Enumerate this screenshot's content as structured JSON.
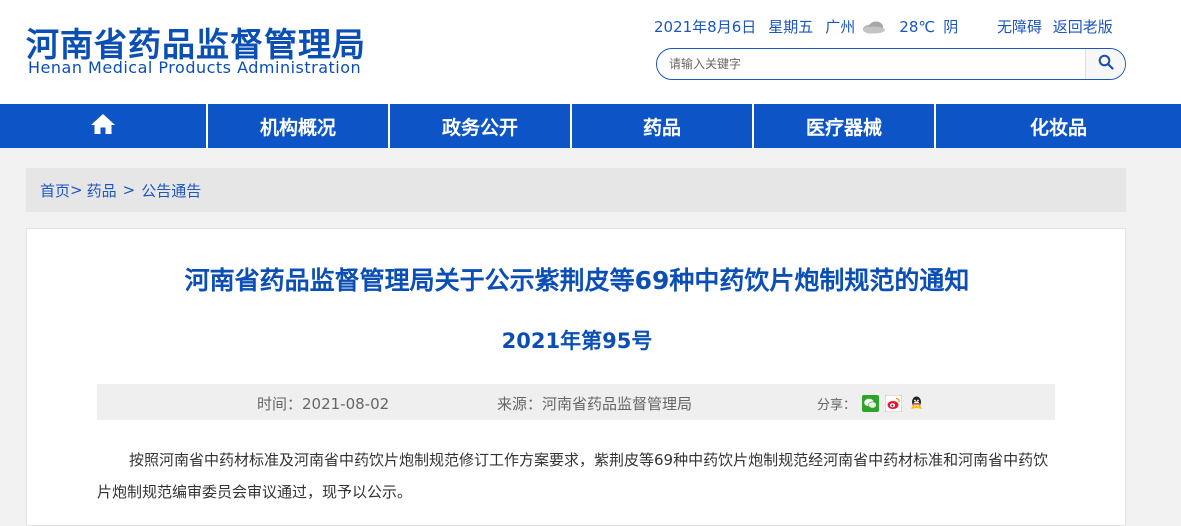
{
  "header": {
    "logo_cn": "河南省药品监督管理局",
    "logo_en": "Henan Medical Products Administration",
    "date": "2021年8月6日",
    "weekday": "星期五",
    "city": "广州",
    "weather_icon": "cloud-icon",
    "temperature": "28℃",
    "weather": "阴",
    "accessibility_link": "无障碍",
    "old_version_link": "返回老版",
    "search_placeholder": "请输入关键字",
    "search_icon": "search-icon"
  },
  "nav": {
    "home_icon": "home-icon",
    "items": [
      "机构概况",
      "政务公开",
      "药品",
      "医疗器械",
      "化妆品"
    ]
  },
  "breadcrumb": {
    "items": [
      "首页",
      "药品",
      "公告通告"
    ],
    "separators": [
      ">",
      ">"
    ]
  },
  "article": {
    "title": "河南省药品监督管理局关于公示紫荆皮等69种中药饮片炮制规范的通知",
    "number": "2021年第95号",
    "time": "时间：2021-08-02",
    "source": "来源：河南省药品监督管理局",
    "share_label": "分享：",
    "share_icons": [
      "wechat-icon",
      "weibo-icon",
      "qq-icon"
    ],
    "body": "按照河南省中药材标准及河南省中药饮片炮制规范修订工作方案要求，紫荆皮等69种中药饮片炮制规范经河南省中药材标准和河南省中药饮片炮制规范编审委员会审议通过，现予以公示。"
  },
  "colors": {
    "brand_blue": "#0b4fb4",
    "nav_blue": "#0d55c6",
    "link_blue": "#1b56c0"
  }
}
